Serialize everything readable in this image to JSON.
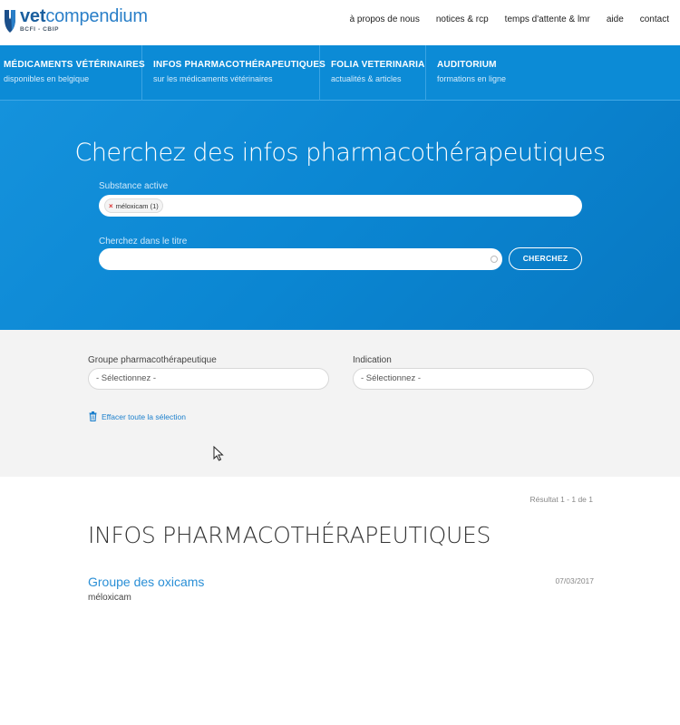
{
  "brand": {
    "name_prefix": "vet",
    "name_suffix": "compendium",
    "subtitle": "BCFI - CBIP",
    "color": "#2a7fc8"
  },
  "top_nav": [
    {
      "label": "à propos de nous"
    },
    {
      "label": "notices & rcp"
    },
    {
      "label": "temps d'attente & lmr"
    },
    {
      "label": "aide"
    },
    {
      "label": "contact"
    }
  ],
  "main_nav": [
    {
      "title": "MÉDICAMENTS VÉTÉRINAIRES",
      "subtitle": "disponibles en belgique"
    },
    {
      "title": "INFOS PHARMACOTHÉRAPEUTIQUES",
      "subtitle": "sur les médicaments vétérinaires"
    },
    {
      "title": "FOLIA VETERINARIA",
      "subtitle": "actualités & articles"
    },
    {
      "title": "AUDITORIUM",
      "subtitle": "formations en ligne"
    }
  ],
  "search": {
    "heading": "Cherchez des infos pharmacothérapeutiques",
    "substance_label": "Substance active",
    "substance_tag": "méloxicam (1)",
    "title_label": "Cherchez dans le titre",
    "title_value": "",
    "button_label": "CHERCHEZ"
  },
  "filters": {
    "group_label": "Groupe pharmacothérapeutique",
    "group_value": "- Sélectionnez -",
    "indication_label": "Indication",
    "indication_value": "- Sélectionnez -",
    "clear_label": "Effacer toute la sélection"
  },
  "results": {
    "count_text": "Résultat 1 - 1 de 1",
    "section_title": "INFOS PHARMACOTHÉRAPEUTIQUES",
    "items": [
      {
        "title": "Groupe des oxicams",
        "subtitle": "méloxicam",
        "date": "07/03/2017"
      }
    ]
  },
  "colors": {
    "primary_blue": "#0c8bd6",
    "link_blue": "#2a8fd6",
    "filter_bg": "#f3f3f3"
  }
}
